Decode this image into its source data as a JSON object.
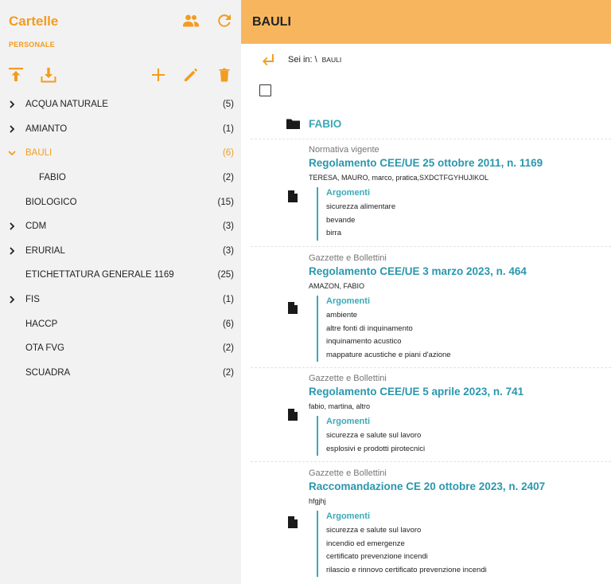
{
  "colors": {
    "accent": "#f39c1f",
    "header_bg": "#f7b65e",
    "link": "#2a97ad",
    "teal": "#3aa9b8"
  },
  "sidebar": {
    "title": "Cartelle",
    "section": "PERSONALE",
    "items": [
      {
        "label": "ACQUA NATURALE",
        "count": "(5)",
        "chevron": "right",
        "active": false,
        "child": false
      },
      {
        "label": "AMIANTO",
        "count": "(1)",
        "chevron": "right",
        "active": false,
        "child": false
      },
      {
        "label": "BAULI",
        "count": "(6)",
        "chevron": "down",
        "active": true,
        "child": false
      },
      {
        "label": "FABIO",
        "count": "(2)",
        "chevron": "none",
        "active": false,
        "child": true
      },
      {
        "label": "BIOLOGICO",
        "count": "(15)",
        "chevron": "none",
        "active": false,
        "child": false
      },
      {
        "label": "CDM",
        "count": "(3)",
        "chevron": "right",
        "active": false,
        "child": false
      },
      {
        "label": "ERURIAL",
        "count": "(3)",
        "chevron": "right",
        "active": false,
        "child": false
      },
      {
        "label": "ETICHETTATURA GENERALE 1169",
        "count": "(25)",
        "chevron": "none",
        "active": false,
        "child": false
      },
      {
        "label": "FIS",
        "count": "(1)",
        "chevron": "right",
        "active": false,
        "child": false
      },
      {
        "label": "HACCP",
        "count": "(6)",
        "chevron": "none",
        "active": false,
        "child": false
      },
      {
        "label": "OTA FVG",
        "count": "(2)",
        "chevron": "none",
        "active": false,
        "child": false
      },
      {
        "label": "SCUADRA",
        "count": "(2)",
        "chevron": "none",
        "active": false,
        "child": false
      }
    ]
  },
  "main": {
    "title": "BAULI",
    "breadcrumb": {
      "prefix": "Sei in:",
      "sep": "\\",
      "current": "BAULI"
    },
    "folder": {
      "name": "FABIO"
    },
    "args_heading": "Argomenti",
    "docs": [
      {
        "category": "Normativa vigente",
        "title": "Regolamento CEE/UE 25 ottobre 2011, n. 1169",
        "tags": "TERESA, MAURO, marco, pratica,SXDCTFGYHUJIKOL",
        "args": [
          "sicurezza alimentare",
          "bevande",
          "birra"
        ]
      },
      {
        "category": "Gazzette e Bollettini",
        "title": "Regolamento CEE/UE 3 marzo 2023, n. 464",
        "tags": "AMAZON, FABIO",
        "args": [
          "ambiente",
          "altre fonti di inquinamento",
          "inquinamento acustico",
          "mappature acustiche e piani d'azione"
        ]
      },
      {
        "category": "Gazzette e Bollettini",
        "title": "Regolamento CEE/UE 5 aprile 2023, n. 741",
        "tags": "fabio, martina, altro",
        "args": [
          "sicurezza e salute sul lavoro",
          "esplosivi e prodotti pirotecnici"
        ]
      },
      {
        "category": "Gazzette e Bollettini",
        "title": "Raccomandazione CE 20 ottobre 2023, n. 2407",
        "tags": "hfgjhj",
        "args": [
          "sicurezza e salute sul lavoro",
          "incendio ed emergenze",
          "certificato prevenzione incendi",
          "rilascio e rinnovo certificato prevenzione incendi"
        ]
      }
    ]
  }
}
